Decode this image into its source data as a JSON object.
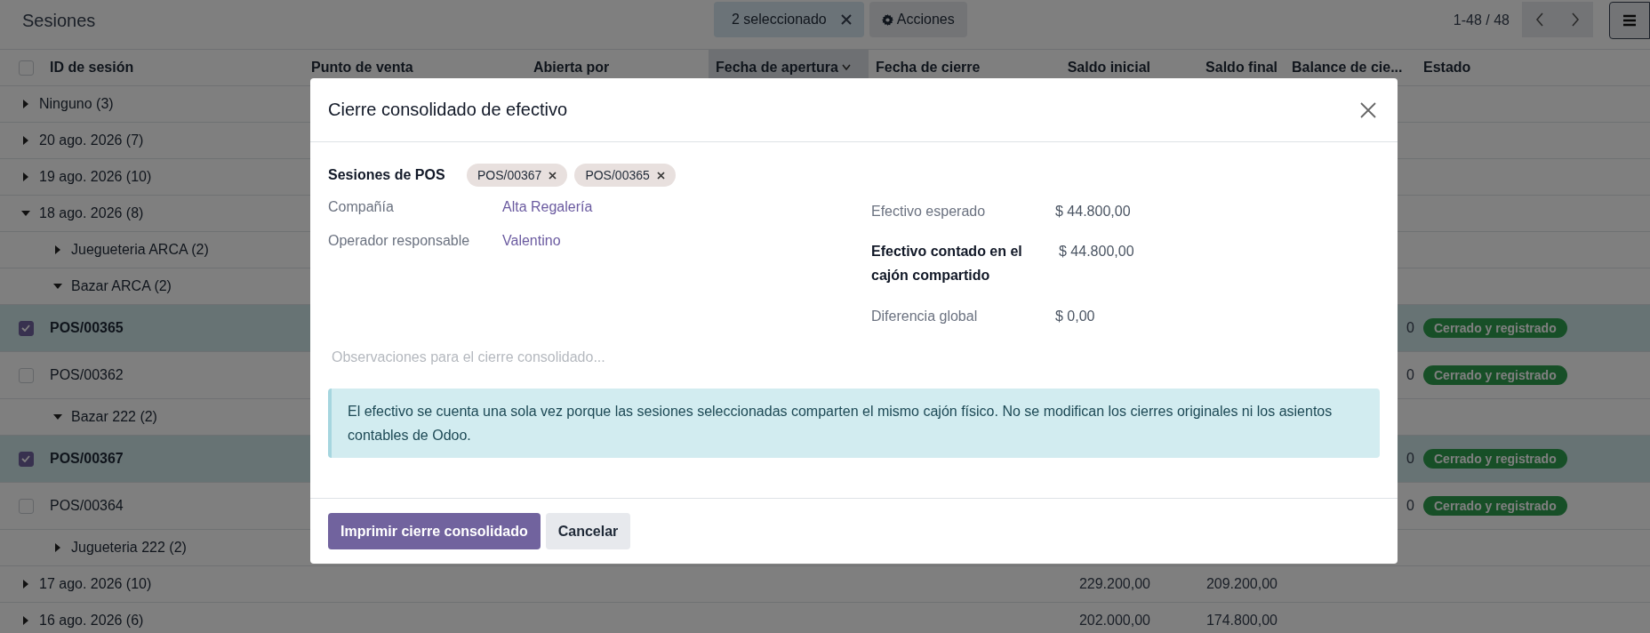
{
  "control_panel": {
    "title": "Sesiones",
    "selection_label": "2 seleccionado",
    "actions_button": "Acciones",
    "pager": "1-48 / 48"
  },
  "table": {
    "select_all": {
      "checked": false
    },
    "columns": [
      {
        "label": "ID de sesión",
        "sorted": false
      },
      {
        "label": "Punto de venta",
        "sorted": false
      },
      {
        "label": "Abierta por",
        "sorted": false
      },
      {
        "label": "Fecha de apertura",
        "sorted": true
      },
      {
        "label": "Fecha de cierre",
        "sorted": false
      },
      {
        "label": "Saldo inicial",
        "sorted": false
      },
      {
        "label": "Saldo final",
        "sorted": false
      },
      {
        "label": "Balance de cie...",
        "sorted": false
      },
      {
        "label": "Estado",
        "sorted": false
      }
    ],
    "rows": [
      {
        "kind": "group",
        "label": "Ninguno (3)",
        "expanded": false
      },
      {
        "kind": "group",
        "label": "20 ago. 2026 (7)",
        "expanded": false
      },
      {
        "kind": "group",
        "label": "19 ago. 2026 (10)",
        "expanded": false
      },
      {
        "kind": "group",
        "label": "18 ago. 2026 (8)",
        "expanded": true,
        "children": [
          {
            "kind": "group",
            "label": "Juegueteria ARCA (2)",
            "expanded": false
          },
          {
            "kind": "group",
            "label": "Bazar ARCA (2)",
            "expanded": true,
            "children": [
              {
                "kind": "record",
                "name": "POS/00365",
                "selected": true,
                "balance": "0",
                "status": "Cerrado y registrado"
              },
              {
                "kind": "record",
                "name": "POS/00362",
                "selected": false,
                "balance": "0",
                "status": "Cerrado y registrado"
              }
            ]
          },
          {
            "kind": "group",
            "label": "Bazar 222 (2)",
            "expanded": true,
            "children": [
              {
                "kind": "record",
                "name": "POS/00367",
                "selected": true,
                "balance": "0",
                "status": "Cerrado y registrado"
              },
              {
                "kind": "record",
                "name": "POS/00364",
                "selected": false,
                "balance": "0",
                "status": "Cerrado y registrado"
              }
            ]
          },
          {
            "kind": "group",
            "label": "Jugueteria 222 (2)",
            "expanded": false
          }
        ]
      },
      {
        "kind": "group",
        "label": "17 ago. 2026 (10)",
        "expanded": false,
        "opening": "229.200,00",
        "closing": "209.200,00"
      },
      {
        "kind": "group",
        "label": "16 ago. 2026 (6)",
        "expanded": false,
        "opening": "202.000,00",
        "closing": "174.800,00"
      }
    ]
  },
  "dialog": {
    "title": "Cierre consolidado de efectivo",
    "sessions": {
      "label": "Sesiones de POS",
      "tags": [
        "POS/00367",
        "POS/00365"
      ]
    },
    "left_fields": [
      {
        "label": "Compañía",
        "value": "Alta Regalería"
      },
      {
        "label": "Operador responsable",
        "value": "Valentino"
      }
    ],
    "right_fields": [
      {
        "label": "Efectivo esperado",
        "value": "$ 44.800,00",
        "emphasis": false
      },
      {
        "label": "Efectivo contado en el cajón compartido",
        "value": "$ 44.800,00",
        "emphasis": true
      },
      {
        "label": "Diferencia global",
        "value": "$ 0,00",
        "emphasis": false
      }
    ],
    "notes": {
      "placeholder": "Observaciones para el cierre consolidado..."
    },
    "alert": "El efectivo se cuenta una sola vez porque las sesiones seleccionadas comparten el mismo cajón físico. No se modifican los cierres originales ni los asientos contables de Odoo.",
    "buttons": [
      {
        "label": "Imprimir cierre consolidado",
        "primary": true
      },
      {
        "label": "Cancelar",
        "primary": false
      }
    ]
  }
}
